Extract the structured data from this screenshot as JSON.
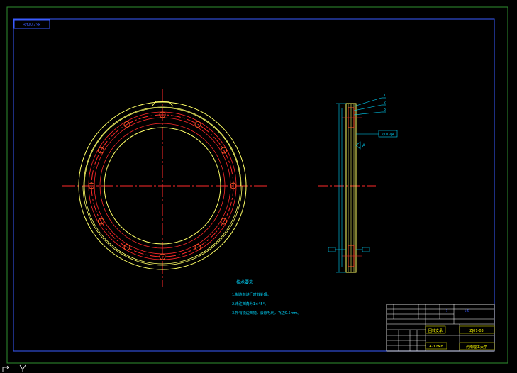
{
  "app": {
    "name": "CAD drawing viewer"
  },
  "colors": {
    "background": "#000000",
    "outer_border": "#2f8f2f",
    "inner_border": "#3a5bff",
    "construction": "#ff2a2a",
    "part": "#ffff66",
    "hole": "#ff5a2a",
    "annotation": "#00d8ff",
    "table_line": "#ffffff",
    "table_fill_accent": "#ffff00"
  },
  "drawing": {
    "sheet_code": "B/NMZ3K",
    "front_view": {
      "bolt_holes": 12
    },
    "side_view": {
      "leader_labels": [
        "1",
        "2",
        "3"
      ],
      "callout": "//|0.02|A",
      "datum": "A"
    },
    "notes": {
      "heading": "技术要求",
      "lines": [
        "1.制造前进行时效处理。",
        "2.未注倒角为1×45°。",
        "3.所有锐边倒钝，去除毛刺，飞边0.5mm。"
      ]
    },
    "title_block": {
      "part_name": "回转支承",
      "drawing_no": "ZJ01-03",
      "school": "河南理工大学",
      "material": "42CrMo",
      "scale": "1:5",
      "sheet": "1"
    }
  }
}
